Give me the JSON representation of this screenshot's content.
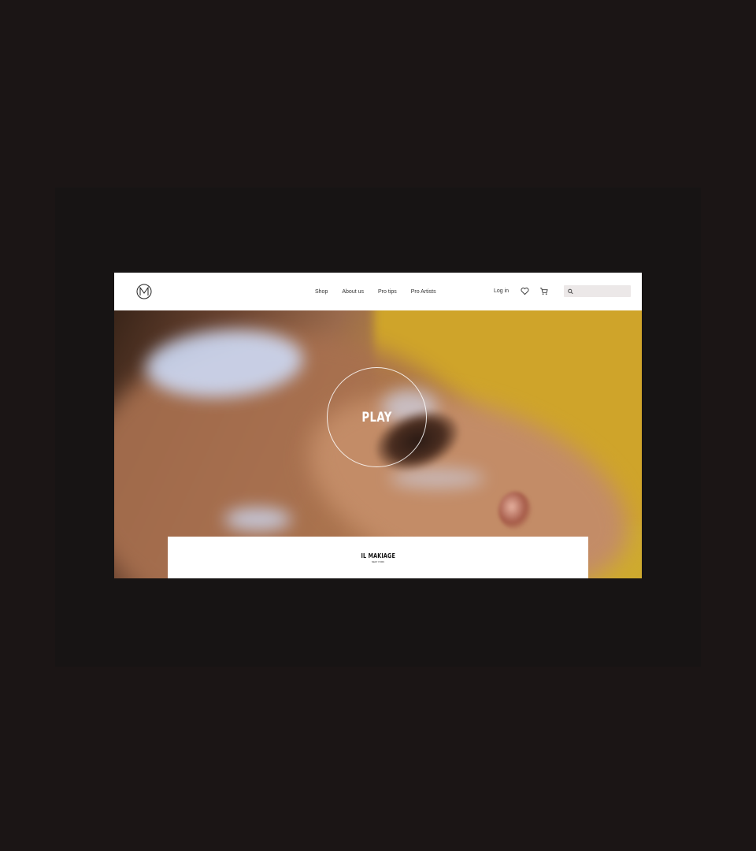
{
  "nav": {
    "logo_icon": "il-makiage-monogram-icon",
    "menu": [
      {
        "label": "Shop"
      },
      {
        "label": "About us"
      },
      {
        "label": "Pro tips"
      },
      {
        "label": "Pro Artists"
      }
    ],
    "login_label": "Log in",
    "wishlist_icon": "heart-icon",
    "cart_icon": "cart-icon",
    "search_icon": "search-icon",
    "search_value": ""
  },
  "hero": {
    "play_label": "PLAY"
  },
  "footer": {
    "brand": "IL MAKIAGE",
    "brand_sub": "NEW YORK"
  },
  "colors": {
    "page_background": "#1b1515",
    "hero_yellow": "#cfa42a",
    "search_background": "#ece8e8"
  }
}
